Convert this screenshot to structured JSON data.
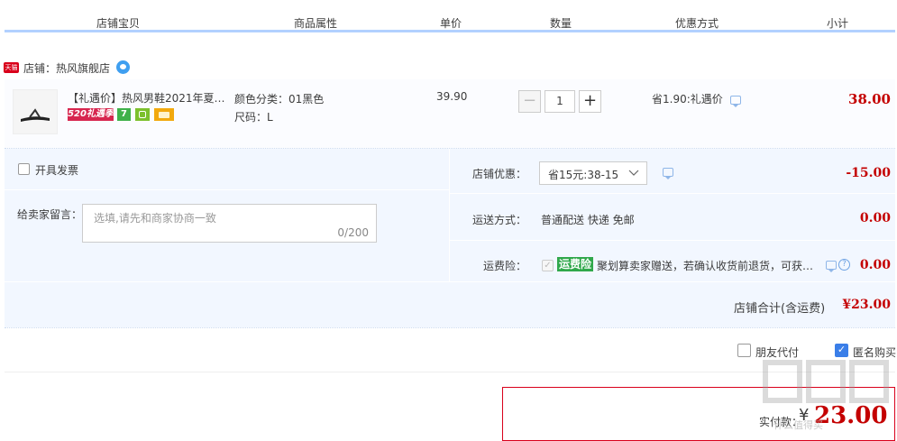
{
  "headers": [
    "店铺宝贝",
    "商品属性",
    "单价",
    "数量",
    "优惠方式",
    "小计"
  ],
  "shop": {
    "badge": "天猫",
    "name": "店铺：热风旗舰店"
  },
  "item": {
    "title": "【礼遇价】热风男鞋2021年夏…",
    "tag_label": "520礼遇季",
    "attr_color": "颜色分类：01黑色",
    "attr_size": "尺码：L",
    "unit_price": "39.90",
    "quantity": "1",
    "minus": "−",
    "plus": "+",
    "discount": "省1.90:礼遇价",
    "subtotal": "38.00"
  },
  "invoice": {
    "label": "开具发票"
  },
  "message": {
    "label": "给卖家留言：",
    "placeholder": "选填,请先和商家协商一致",
    "counter": "0/200"
  },
  "shop_coupon": {
    "label": "店铺优惠：",
    "value": "省15元:38-15",
    "amount": "-15.00"
  },
  "delivery": {
    "label": "运送方式：",
    "value": "普通配送 快递 免邮",
    "amount": "0.00"
  },
  "insurance": {
    "label": "运费险：",
    "badge": "运费险",
    "text": "聚划算卖家赠送，若确认收货前退货，可获…",
    "amount": "0.00"
  },
  "shop_total": {
    "label": "店铺合计(含运费)",
    "amount": "¥23.00"
  },
  "friend_pay": {
    "label": "朋友代付"
  },
  "anonymous": {
    "label": "匿名购买",
    "checked": true
  },
  "final": {
    "label": "实付款：",
    "currency": "¥",
    "amount": "23.00"
  },
  "watermark": "什么值得买",
  "colors": {
    "accent_red": "#c40000",
    "border_blue": "#b2d1ff",
    "panel_bg": "#f2f7ff",
    "green_badge": "#30a84b"
  }
}
